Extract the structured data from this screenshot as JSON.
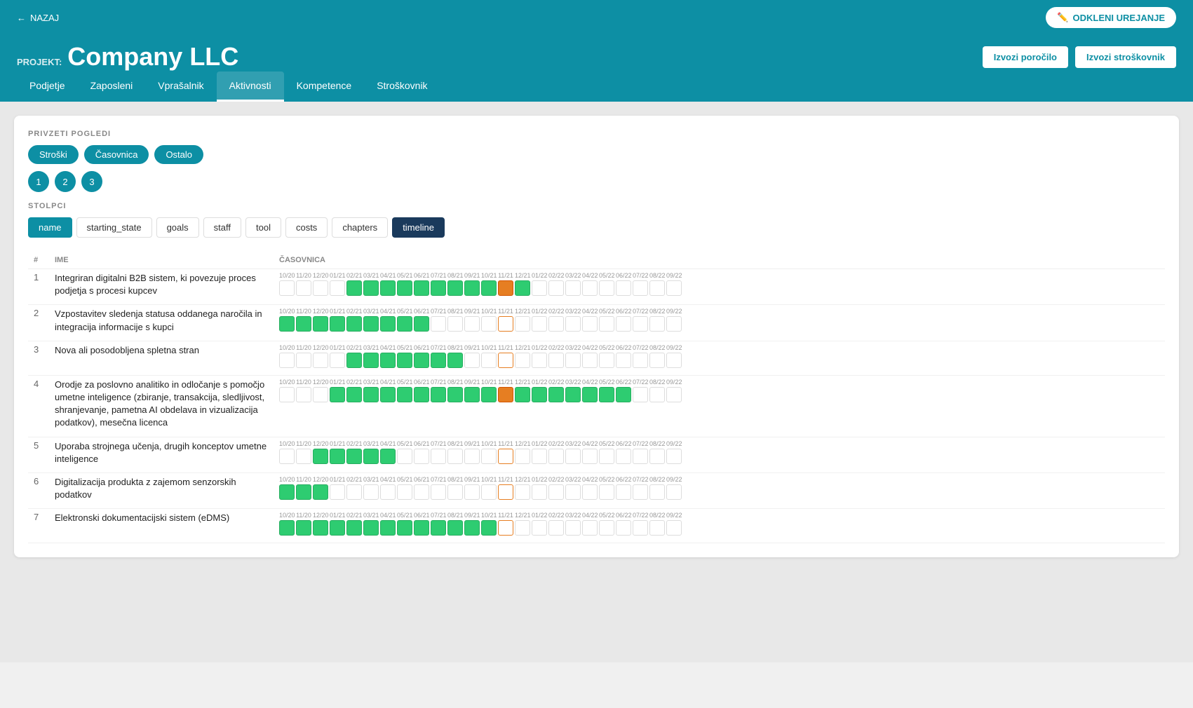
{
  "topbar": {
    "back_label": "NAZAJ",
    "unlock_label": "ODKLENI UREJANJE"
  },
  "header": {
    "project_prefix": "PROJEKT:",
    "project_name": "Company LLC",
    "export_report": "Izvozi poročilo",
    "export_costs": "Izvozi stroškovnik"
  },
  "nav": {
    "items": [
      {
        "label": "Podjetje",
        "active": false
      },
      {
        "label": "Zaposleni",
        "active": false
      },
      {
        "label": "Vprašalnik",
        "active": false
      },
      {
        "label": "Aktivnosti",
        "active": true
      },
      {
        "label": "Kompetence",
        "active": false
      },
      {
        "label": "Stroškovnik",
        "active": false
      }
    ]
  },
  "views": {
    "section_label": "PRIVZETI POGLEDI",
    "pills": [
      "Stroški",
      "Časovnica",
      "Ostalo"
    ],
    "numbers": [
      "1",
      "2",
      "3"
    ]
  },
  "columns": {
    "section_label": "STOLPCI",
    "items": [
      {
        "label": "name",
        "active": "teal"
      },
      {
        "label": "starting_state",
        "active": "none"
      },
      {
        "label": "goals",
        "active": "none"
      },
      {
        "label": "staff",
        "active": "none"
      },
      {
        "label": "tool",
        "active": "none"
      },
      {
        "label": "costs",
        "active": "none"
      },
      {
        "label": "chapters",
        "active": "none"
      },
      {
        "label": "timeline",
        "active": "dark"
      }
    ]
  },
  "table": {
    "col_num": "#",
    "col_name": "IME",
    "col_timeline": "ČASOVNICA",
    "months": [
      "10/20",
      "11/20",
      "12/20",
      "01/21",
      "02/21",
      "03/21",
      "04/21",
      "05/21",
      "06/21",
      "07/21",
      "08/21",
      "09/21",
      "10/21",
      "11/21",
      "12/21",
      "01/22",
      "02/22",
      "03/22",
      "04/22",
      "05/22",
      "06/22",
      "07/22",
      "08/22",
      "09/22"
    ],
    "rows": [
      {
        "num": "1",
        "name": "Integriran digitalni B2B sistem, ki povezuje proces podjetja s procesi kupcev",
        "boxes": [
          "empty",
          "empty",
          "empty",
          "empty",
          "green",
          "green",
          "green",
          "green",
          "green",
          "green",
          "green",
          "green",
          "green",
          "orange",
          "green",
          "empty",
          "empty",
          "empty",
          "empty",
          "empty",
          "empty",
          "empty",
          "empty",
          "empty"
        ]
      },
      {
        "num": "2",
        "name": "Vzpostavitev sledenja statusa oddanega naročila in integracija informacije s kupci",
        "boxes": [
          "green",
          "green",
          "green",
          "green",
          "green",
          "green",
          "green",
          "green",
          "green",
          "empty",
          "empty",
          "empty",
          "empty",
          "orange-border",
          "empty",
          "empty",
          "empty",
          "empty",
          "empty",
          "empty",
          "empty",
          "empty",
          "empty",
          "empty"
        ]
      },
      {
        "num": "3",
        "name": "Nova ali posodobljena spletna stran",
        "boxes": [
          "empty",
          "empty",
          "empty",
          "empty",
          "green",
          "green",
          "green",
          "green",
          "green",
          "green",
          "green",
          "empty",
          "empty",
          "orange-border",
          "empty",
          "empty",
          "empty",
          "empty",
          "empty",
          "empty",
          "empty",
          "empty",
          "empty",
          "empty"
        ]
      },
      {
        "num": "4",
        "name": "Orodje za poslovno analitiko in odločanje s pomočjo umetne inteligence (zbiranje, transakcija, sledljivost, shranjevanje, pametna AI obdelava in vizualizacija podatkov), mesečna licenca",
        "boxes": [
          "empty",
          "empty",
          "empty",
          "green",
          "green",
          "green",
          "green",
          "green",
          "green",
          "green",
          "green",
          "green",
          "green",
          "orange",
          "green",
          "green",
          "green",
          "green",
          "green",
          "green",
          "green",
          "empty",
          "empty",
          "empty"
        ]
      },
      {
        "num": "5",
        "name": "Uporaba strojnega učenja, drugih konceptov umetne inteligence",
        "boxes": [
          "empty",
          "empty",
          "green",
          "green",
          "green",
          "green",
          "green",
          "empty",
          "empty",
          "empty",
          "empty",
          "empty",
          "empty",
          "orange-border",
          "empty",
          "empty",
          "empty",
          "empty",
          "empty",
          "empty",
          "empty",
          "empty",
          "empty",
          "empty"
        ]
      },
      {
        "num": "6",
        "name": "Digitalizacija produkta z zajemom senzorskih podatkov",
        "boxes": [
          "green",
          "green",
          "green",
          "empty",
          "empty",
          "empty",
          "empty",
          "empty",
          "empty",
          "empty",
          "empty",
          "empty",
          "empty",
          "orange-border",
          "empty",
          "empty",
          "empty",
          "empty",
          "empty",
          "empty",
          "empty",
          "empty",
          "empty",
          "empty"
        ]
      },
      {
        "num": "7",
        "name": "Elektronski dokumentacijski sistem (eDMS)",
        "boxes": [
          "green",
          "green",
          "green",
          "green",
          "green",
          "green",
          "green",
          "green",
          "green",
          "green",
          "green",
          "green",
          "green",
          "orange-border",
          "empty",
          "empty",
          "empty",
          "empty",
          "empty",
          "empty",
          "empty",
          "empty",
          "empty",
          "empty"
        ]
      }
    ]
  }
}
